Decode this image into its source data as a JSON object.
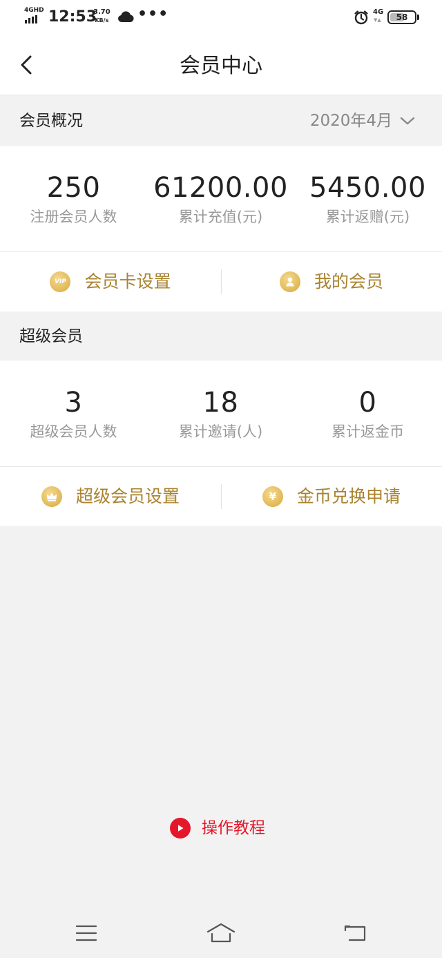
{
  "status_bar": {
    "network_tag": "4GHD",
    "time": "12:53",
    "speed_value": "3.70",
    "speed_unit": "KB/s",
    "dots": "•••",
    "network_type": "4G",
    "battery": "58",
    "battery_level": 0.58,
    "icons": [
      "signal-icon",
      "cloud-icon",
      "alarm-icon",
      "battery-icon"
    ]
  },
  "header": {
    "title": "会员中心",
    "back_icon": "chevron-left-icon"
  },
  "member_overview": {
    "title": "会员概况",
    "month": "2020年4月",
    "stats": [
      {
        "value": "250",
        "label": "注册会员人数"
      },
      {
        "value": "61200.00",
        "label": "累计充值(元)"
      },
      {
        "value": "5450.00",
        "label": "累计返赠(元)"
      }
    ],
    "actions": [
      {
        "label": "会员卡设置",
        "icon": "vip-icon",
        "icon_text": "VIP"
      },
      {
        "label": "我的会员",
        "icon": "user-icon"
      }
    ]
  },
  "super_member": {
    "title": "超级会员",
    "stats": [
      {
        "value": "3",
        "label": "超级会员人数"
      },
      {
        "value": "18",
        "label": "累计邀请(人)"
      },
      {
        "value": "0",
        "label": "累计返金币"
      }
    ],
    "actions": [
      {
        "label": "超级会员设置",
        "icon": "crown-icon"
      },
      {
        "label": "金币兑换申请",
        "icon": "yen-icon",
        "icon_text": "¥"
      }
    ]
  },
  "tutorial": {
    "label": "操作教程",
    "icon": "play-icon"
  },
  "colors": {
    "gold": "#a9832e",
    "gold_icon": "#e0b24c",
    "red": "#e4172b",
    "background": "#f2f2f2"
  },
  "bottom_nav": [
    "menu-icon",
    "home-icon",
    "back-icon"
  ]
}
